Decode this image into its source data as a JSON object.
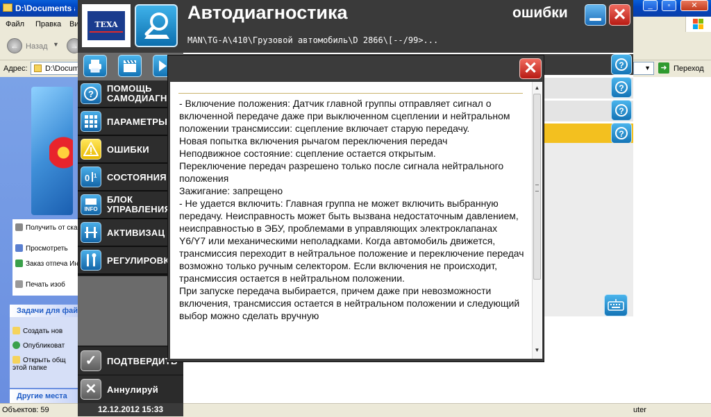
{
  "explorer": {
    "title": "D:\\Documents and",
    "menu": [
      "Файл",
      "Правка",
      "Ви"
    ],
    "back_label": "Назад",
    "address_label": "Адрес:",
    "address_value": "D:\\Docum",
    "go_label": "Переход",
    "picture_tasks": [
      "Получить от сканера",
      "Просмотреть",
      "Заказ отпеча Интернет",
      "Печать изоб"
    ],
    "file_tasks_title": "Задачи для фай",
    "file_tasks": [
      "Создать нов",
      "Опубликоват",
      "Открыть общ этой папке"
    ],
    "other_places_title": "Другие места",
    "status_left": "Объектов: 59",
    "status_right": "uter"
  },
  "app": {
    "logo": "TEXA",
    "title": "Автодиагностика",
    "path": "MAN\\TG-A\\410\\Грузовой автомобиль\\D 2866\\[--/99>...",
    "mode": "ошибки",
    "datetime": "12.12.2012  15:33",
    "colors": {
      "header": "#3a3a3a",
      "sidebar": "#1c1c1c",
      "accent_blue": "#1474b6",
      "selected_row": "#f3c01f",
      "close_red": "#b81b14"
    }
  },
  "nav": [
    {
      "label": "ПОМОЩЬ САМОДИАГН",
      "line1": "ПОМОЩЬ",
      "line2": "САМОДИАГН",
      "icon": "help-circle-icon"
    },
    {
      "label": "ПАРАМЕТРЫ",
      "icon": "grid-icon"
    },
    {
      "label": "ОШИБКИ",
      "icon": "warning-icon"
    },
    {
      "label": "СОСТОЯНИЯ",
      "icon": "states-icon"
    },
    {
      "label": "БЛОК УПРАВЛЕНИЯ",
      "line1": "БЛОК",
      "line2": "УПРАВЛЕНИЯ",
      "icon": "info-icon"
    },
    {
      "label": "АКТИВИЗАЦ",
      "icon": "activation-icon"
    },
    {
      "label": "РЕГУЛИРОВК",
      "icon": "tools-icon"
    }
  ],
  "actions": {
    "confirm_label": "ПОДТВЕРДИТЬ",
    "cancel_label": "Аннулируй"
  },
  "popup": {
    "close_symbol": "✕",
    "paragraphs": [
      "- Включение положения: Датчик главной группы отправляет сигнал о включенной передаче даже при выключенном сцеплении и нейтральном положении трансмиссии: сцепление включает старую передачу.",
      "Новая попытка включения рычагом переключения передач",
      "Неподвижное состояние: сцепление остается открытым.",
      "Переключение передач разрешено только после сигнала нейтрального положения",
      "Зажигание: запрещено",
      "- Не удается включить: Главная группа не может включить выбранную передачу. Неисправность может быть вызвана недостаточным давлением, неисправностью в ЭБУ, проблемами в управляющих электроклапанах Y6/Y7 или механическими неполадками. Когда автомобиль движется, трансмиссия переходит в нейтральное положение и переключение передач возможно только ручным селектором. Если включения не происходит, трансмиссия остается в нейтральном положении.",
      "При запуске передача выбирается, причем даже при невозможности включения, трансмиссия остается в нейтральном положении и следующий выбор можно сделать вручную"
    ]
  }
}
